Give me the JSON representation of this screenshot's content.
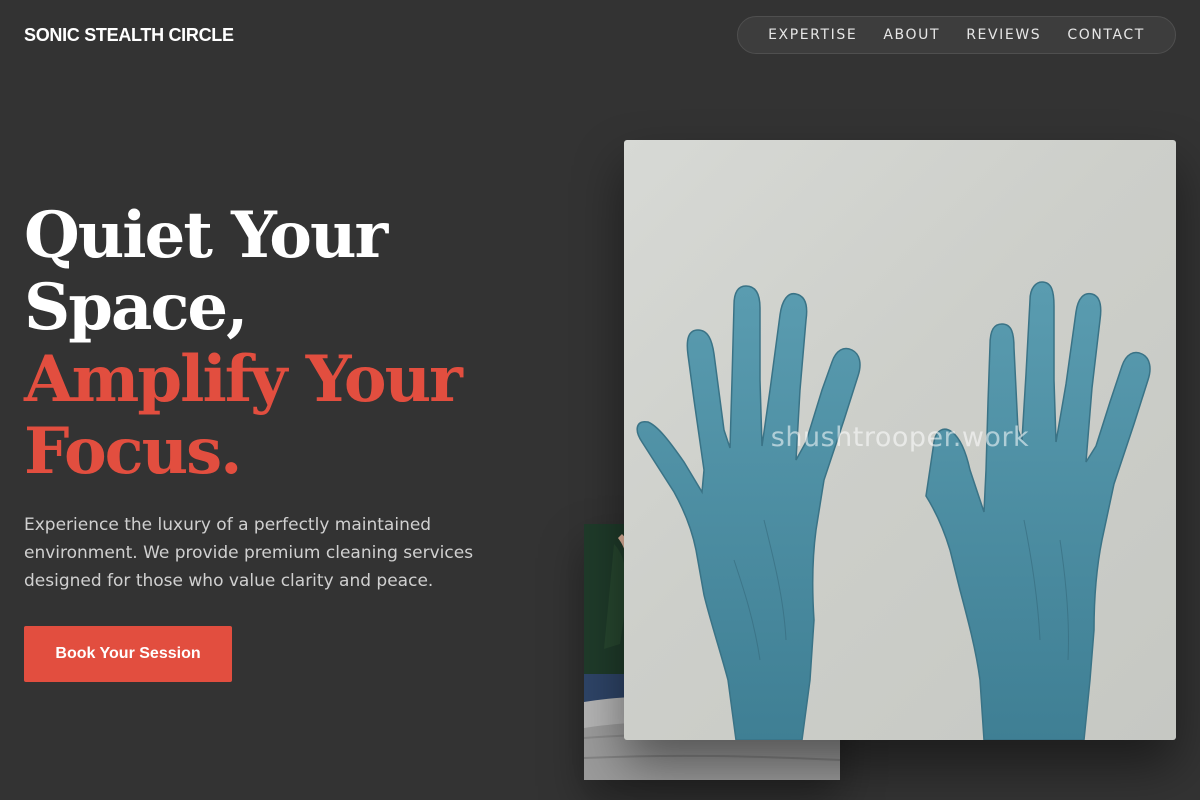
{
  "header": {
    "brand": "SONIC STEALTH CIRCLE",
    "nav": [
      "EXPERTISE",
      "ABOUT",
      "REVIEWS",
      "CONTACT"
    ]
  },
  "hero": {
    "headline_lines": [
      "Quiet Your",
      "Space,"
    ],
    "accent_lines": [
      "Amplify Your",
      "Focus."
    ],
    "description": "Experience the luxury of a perfectly maintained environment. We provide premium cleaning services designed for those who value clarity and peace.",
    "cta_label": "Book Your Session"
  },
  "images": {
    "main_watermark": "shushtrooper.work"
  },
  "colors": {
    "background": "#333333",
    "accent": "#e24e3f",
    "text": "#ffffff",
    "glove": "#4e8fa3"
  }
}
